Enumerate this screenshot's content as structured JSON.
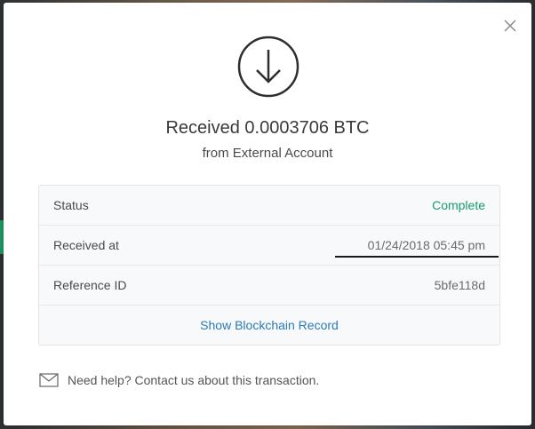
{
  "modal": {
    "title": "Received 0.0003706 BTC",
    "subtitle": "from External Account",
    "icons": {
      "receive": "download-arrow-icon",
      "close": "close-icon",
      "mail": "envelope-icon"
    }
  },
  "details": {
    "rows": [
      {
        "label": "Status",
        "value": "Complete"
      },
      {
        "label": "Received at",
        "value": "01/24/2018 05:45 pm"
      },
      {
        "label": "Reference ID",
        "value": "5bfe118d"
      }
    ],
    "blockchain_link": "Show Blockchain Record"
  },
  "help": {
    "text": "Need help? Contact us about this transaction."
  },
  "colors": {
    "status_complete": "#1a9b6c",
    "link": "#2a7ab8"
  }
}
